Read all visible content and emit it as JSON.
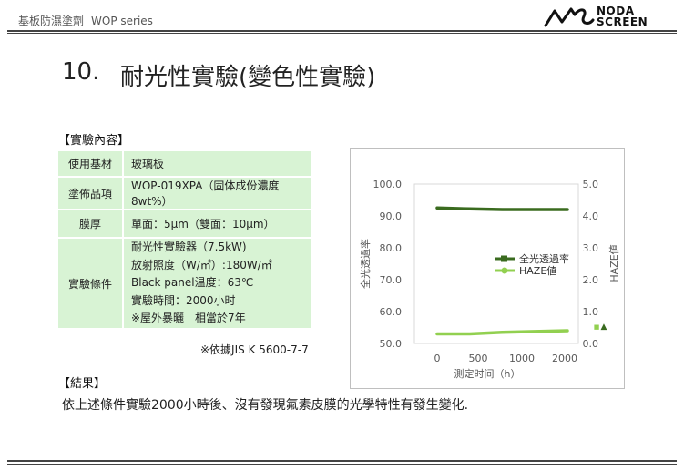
{
  "header": {
    "category": "基板防濕塗劑",
    "series": "WOP series",
    "brand_line1": "NODA",
    "brand_line2": "SCREEN"
  },
  "title": {
    "number": "10.",
    "text": "耐光性實驗(變色性實驗)"
  },
  "content_section": {
    "label": "【實驗內容】",
    "rows": [
      {
        "key": "使用基材",
        "lines": [
          "玻璃板"
        ]
      },
      {
        "key": "塗佈品項",
        "lines": [
          "WOP-019XPA（固体成份濃度8wt%）"
        ]
      },
      {
        "key": "膜厚",
        "lines": [
          "單面：5μm（雙面：10μm）"
        ]
      },
      {
        "key": "實驗條件",
        "lines": [
          "耐光性實驗器（7.5kW)",
          "放射照度（W/㎡）:180W/㎡",
          "Black panel温度：63℃",
          "實驗時間：2000小时",
          "※屋外暴曬　相當於7年"
        ]
      }
    ],
    "reference": "※依據JIS K 5600-7-7"
  },
  "result_section": {
    "label": "【結果】",
    "text": "依上述條件實驗2000小時後、沒有發現氟素皮膜的光學特性有發生變化."
  },
  "colors": {
    "series_transmittance": "#3a6b1f",
    "series_haze": "#92d050",
    "table_fill": "#d8f3d4"
  },
  "chart_data": {
    "type": "line",
    "title": "",
    "xlabel": "測定时间（h）",
    "ylabel_left": "全光透過率",
    "ylabel_right": "HAZE値",
    "x_ticks": [
      "0",
      "500",
      "1000",
      "2000"
    ],
    "xlim": [
      0,
      2000
    ],
    "ylim_left": [
      50,
      100
    ],
    "ylim_right": [
      0,
      5
    ],
    "y_ticks_left": [
      "50.0",
      "60.0",
      "70.0",
      "80.0",
      "90.0",
      "100.0"
    ],
    "y_ticks_right": [
      "0.0",
      "1.0",
      "2.0",
      "3.0",
      "4.0",
      "5.0"
    ],
    "grid": false,
    "legend_position": "right",
    "series": [
      {
        "name": "全光透過率",
        "axis": "left",
        "x": [
          0,
          500,
          1000,
          2000
        ],
        "y": [
          92.5,
          92.2,
          92.0,
          92.0
        ]
      },
      {
        "name": "HAZE値",
        "axis": "right",
        "x": [
          0,
          500,
          1000,
          2000
        ],
        "y": [
          0.3,
          0.3,
          0.35,
          0.4
        ]
      }
    ],
    "side_marks": {
      "triangle": "▲",
      "square": "■"
    }
  }
}
